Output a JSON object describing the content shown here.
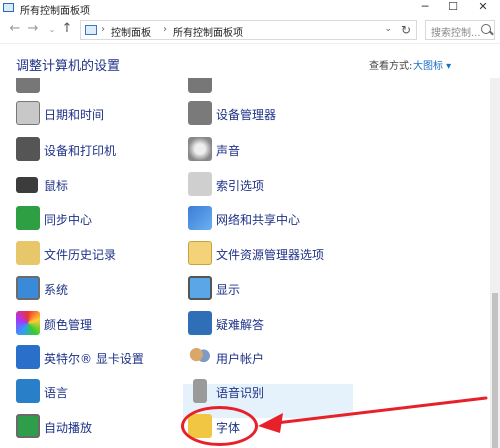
{
  "window": {
    "title": "所有控制面板项",
    "minimize": "─",
    "maximize": "☐",
    "close": "✕"
  },
  "nav": {
    "back": "←",
    "forward": "→",
    "recent": "⌄",
    "up": "↑",
    "breadcrumb": [
      "控制面板",
      "所有控制面板项"
    ],
    "separator": "›",
    "dropdown": "⌄",
    "refresh": "↻",
    "search_placeholder": "搜索控制..."
  },
  "header": {
    "title": "调整计算机的设置",
    "view_by_label": "查看方式:",
    "view_by_value": "大图标 ▾"
  },
  "items": {
    "left": [
      {
        "label": "日期和时间",
        "icon": "clock-icon"
      },
      {
        "label": "设备和打印机",
        "icon": "printer-icon"
      },
      {
        "label": "鼠标",
        "icon": "mouse-icon"
      },
      {
        "label": "同步中心",
        "icon": "sync-icon"
      },
      {
        "label": "文件历史记录",
        "icon": "file-history-icon"
      },
      {
        "label": "系统",
        "icon": "computer-icon"
      },
      {
        "label": "颜色管理",
        "icon": "color-icon"
      },
      {
        "label": "英特尔® 显卡设置",
        "icon": "intel-graphics-icon"
      },
      {
        "label": "语言",
        "icon": "language-icon"
      },
      {
        "label": "自动播放",
        "icon": "autoplay-icon"
      }
    ],
    "right": [
      {
        "label": "设备管理器",
        "icon": "device-manager-icon"
      },
      {
        "label": "声音",
        "icon": "speaker-icon"
      },
      {
        "label": "索引选项",
        "icon": "indexing-icon"
      },
      {
        "label": "网络和共享中心",
        "icon": "network-icon"
      },
      {
        "label": "文件资源管理器选项",
        "icon": "folder-options-icon"
      },
      {
        "label": "显示",
        "icon": "monitor-icon"
      },
      {
        "label": "疑难解答",
        "icon": "troubleshoot-icon"
      },
      {
        "label": "用户帐户",
        "icon": "users-icon"
      },
      {
        "label": "语音识别",
        "icon": "microphone-icon"
      },
      {
        "label": "字体",
        "icon": "font-icon"
      }
    ]
  },
  "colors": {
    "link": "#1e3287",
    "highlight": "#e5f1fb",
    "annotation": "#e8202a"
  }
}
